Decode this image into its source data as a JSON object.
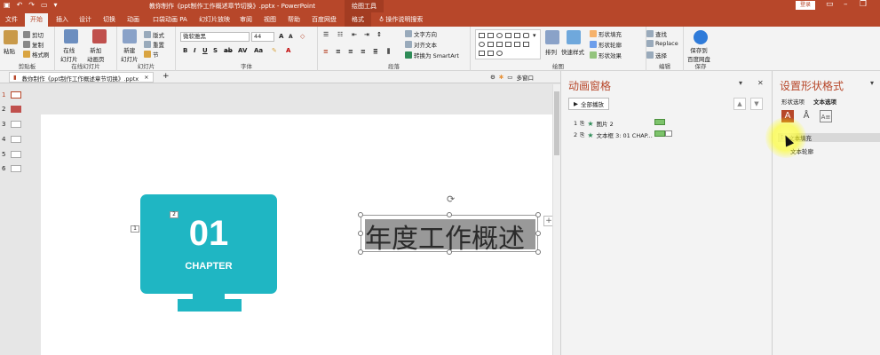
{
  "titlebar": {
    "doc_title": "教你制作《ppt制作工作概述章节切换》.pptx - PowerPoint",
    "context_tab": "绘图工具",
    "login": "登录"
  },
  "tabs": [
    "文件",
    "开始",
    "插入",
    "设计",
    "切换",
    "动画",
    "口袋动画 PA",
    "幻灯片放映",
    "审阅",
    "视图",
    "帮助",
    "百度网盘",
    "格式"
  ],
  "search": "操作说明搜索",
  "ribbon": {
    "clipboard": {
      "paste": "粘贴",
      "cut": "剪切",
      "copy": "复制",
      "format_painter": "格式刷",
      "label": "剪贴板"
    },
    "online_slides": {
      "btn1": "在线\n幻灯片",
      "btn2": "新加\n动画页",
      "label": "在线幻灯片"
    },
    "slides": {
      "new_slide": "新建\n幻灯片",
      "layout": "版式",
      "reset": "重置",
      "section": "节",
      "label": "幻灯片"
    },
    "font": {
      "name": "微软雅黑",
      "size": "44",
      "label": "字体"
    },
    "paragraph": {
      "text_direction": "文字方向",
      "align_text": "对齐文本",
      "smartart": "转换为 SmartArt",
      "label": "段落"
    },
    "drawing": {
      "arrange": "排列",
      "quick_styles": "快速样式",
      "fill": "形状填充",
      "outline": "形状轮廓",
      "effect": "形状效果",
      "label": "绘图"
    },
    "editing": {
      "find": "查找",
      "replace": "Replace",
      "select": "选择",
      "label": "编辑"
    },
    "save": {
      "btn": "保存到\n百度网盘",
      "label": "保存"
    }
  },
  "doc_tab": {
    "name": "教你制作《ppt制作工作概述章节切换》.pptx",
    "close": "×",
    "multi_window": "多窗口"
  },
  "slides": [
    {
      "num": "1"
    },
    {
      "num": "2"
    },
    {
      "num": "3"
    },
    {
      "num": "4"
    },
    {
      "num": "5"
    },
    {
      "num": "6"
    }
  ],
  "slide_content": {
    "chapter_num": "01",
    "chapter_word": "CHAPTER",
    "tag1": "1",
    "tag2": "2",
    "title_text": "年度工作概述"
  },
  "anim_pane": {
    "title": "动画窗格",
    "play_all": "全部播放",
    "items": [
      {
        "num": "1",
        "name": "图片 2"
      },
      {
        "num": "2",
        "name": "文本框 3: 01 CHAP..."
      }
    ]
  },
  "format_pane": {
    "title": "设置形状格式",
    "tab_shape": "形状选项",
    "tab_text": "文本选项",
    "section_fill": "文本填充",
    "section_outline": "文本轮廓"
  },
  "colors": {
    "accent": "#b7472a",
    "teal": "#1fb6c3",
    "anim_bar": "#7dc36b"
  }
}
